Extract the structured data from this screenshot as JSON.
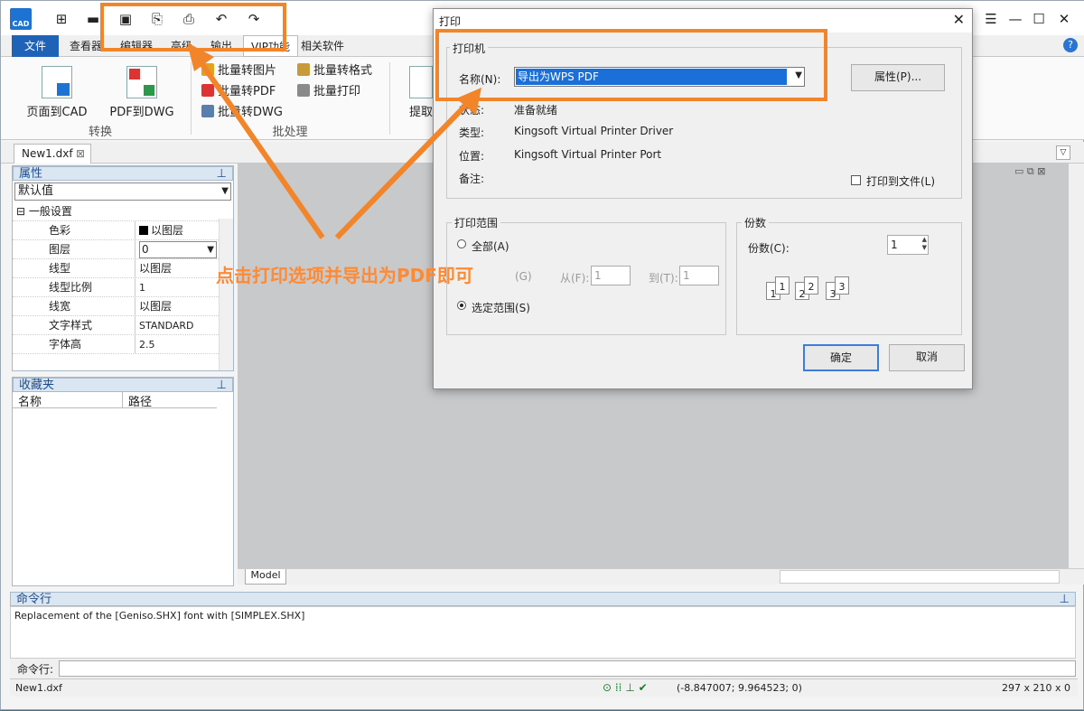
{
  "app": {
    "logo_text": "CAD",
    "window_controls": [
      "—",
      "☐",
      "✕"
    ]
  },
  "menu": {
    "tabs": [
      "文件",
      "查看器",
      "编辑器",
      "高级",
      "输出",
      "VIP功能",
      "相关软件"
    ]
  },
  "ribbon": {
    "page_to_cad": "页面到CAD",
    "pdf_to_dwg": "PDF到DWG",
    "group_convert": "转换",
    "batch_to_image": "批量转图片",
    "batch_to_pdf": "批量转PDF",
    "batch_to_dwg": "批量转DWG",
    "batch_format": "批量转格式",
    "batch_print": "批量打印",
    "group_batch": "批处理",
    "extract": "提取"
  },
  "doc_tab": {
    "name": "New1.dxf"
  },
  "properties": {
    "title": "属性",
    "selector": "默认值",
    "section": "一般设置",
    "rows": [
      {
        "name": "色彩",
        "value": "以图层"
      },
      {
        "name": "图层",
        "value": "0"
      },
      {
        "name": "线型",
        "value": "以图层"
      },
      {
        "name": "线型比例",
        "value": "1"
      },
      {
        "name": "线宽",
        "value": "以图层"
      },
      {
        "name": "文字样式",
        "value": "STANDARD"
      },
      {
        "name": "字体高",
        "value": "2.5"
      }
    ]
  },
  "favorites": {
    "title": "收藏夹",
    "col_name": "名称",
    "col_path": "路径"
  },
  "canvas": {
    "model_tab": "Model"
  },
  "command": {
    "title": "命令行",
    "output": "Replacement of the [Geniso.SHX] font with [SIMPLEX.SHX]",
    "prompt_label": "命令行:"
  },
  "status": {
    "file": "New1.dxf",
    "coords": "(-8.847007; 9.964523; 0)",
    "paper": "297 x 210 x 0"
  },
  "dialog": {
    "title": "打印",
    "printer_group": "打印机",
    "name_label": "名称(N):",
    "printer_name": "导出为WPS PDF",
    "properties_btn": "属性(P)...",
    "status_label": "状态:",
    "status_value": "准备就绪",
    "type_label": "类型:",
    "type_value": "Kingsoft Virtual Printer Driver",
    "where_label": "位置:",
    "where_value": "Kingsoft Virtual Printer Port",
    "comment_label": "备注:",
    "print_to_file": "打印到文件(L)",
    "range_group": "打印范围",
    "range_all": "全部(A)",
    "range_pages": "(G)",
    "from_label": "从(F):",
    "from_value": "1",
    "to_label": "到(T):",
    "to_value": "1",
    "range_selection": "选定范围(S)",
    "copies_group": "份数",
    "copies_label": "份数(C):",
    "copies_value": "1",
    "ok": "确定",
    "cancel": "取消"
  },
  "annotation": {
    "text": "点击打印选项并导出为PDF即可",
    "color": "#f2842a"
  }
}
